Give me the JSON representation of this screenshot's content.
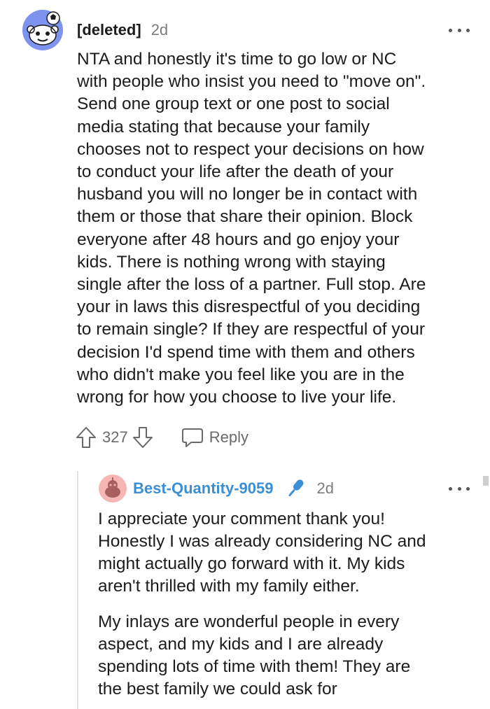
{
  "comment": {
    "author": "[deleted]",
    "age": "2d",
    "body": "NTA and honestly it's time to go low or NC\nwith people who insist you need to \"move on\".\nSend one group text or one post to social\nmedia stating that because your family\nchooses not to respect your decisions on how\nto conduct your life after the death of your\nhusband you will no longer be in contact with\nthem or those that share their opinion. Block\neveryone after 48 hours and go enjoy your\nkids. There is nothing wrong with staying\nsingle after the loss of a partner. Full stop. Are\nyour in laws this disrespectful of you deciding\nto remain single? If they are respectful of your\ndecision I'd spend time with them and others\nwho didn't make you feel like you are in the\nwrong for how you choose to live your life.",
    "score": "327",
    "reply_label": "Reply",
    "avatar_icon": "snoo-avatar-icon"
  },
  "reply": {
    "author": "Best-Quantity-9059",
    "age": "2d",
    "badge_icon": "microphone-icon",
    "paragraph1": "I appreciate your comment thank you!\nHonestly I was already considering NC and\nmight actually go forward with it. My kids\naren't thrilled with my family either.",
    "paragraph2": "My inlays are wonderful people in every\naspect, and my kids and I are already\nspending lots of time with them! They are\nthe best family we could ask for",
    "avatar_icon": "user-avatar-icon"
  },
  "colors": {
    "op_name": "#3a8fd6",
    "avatar_bg": "#7d93ee",
    "reply_avatar_bg": "#f6b6b6"
  }
}
